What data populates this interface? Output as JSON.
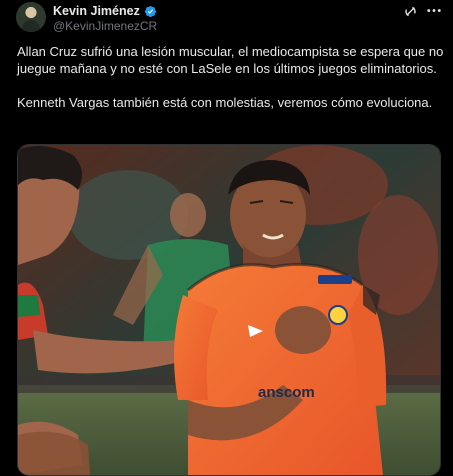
{
  "author": {
    "display_name": "Kevin Jiménez",
    "handle": "@KevinJimenezCR",
    "verified": true,
    "verified_color": "#1d9bf0"
  },
  "tweet": {
    "paragraphs": [
      "Allan Cruz sufrió una lesión muscular, el mediocampista se espera que no juegue mañana y no esté con LaSele en los últimos juegos eliminatorios.",
      "Kenneth Vargas también está con molestias, veremos cómo evoluciona."
    ]
  },
  "media": {
    "jersey_sponsor": "anscom"
  },
  "icons": {
    "grok": "grok-icon",
    "more": "more-icon",
    "verified": "verified-badge-icon"
  },
  "colors": {
    "background": "#000000",
    "text": "#e7e9ea",
    "secondary_text": "#71767b",
    "jersey": "#f26a2c"
  }
}
